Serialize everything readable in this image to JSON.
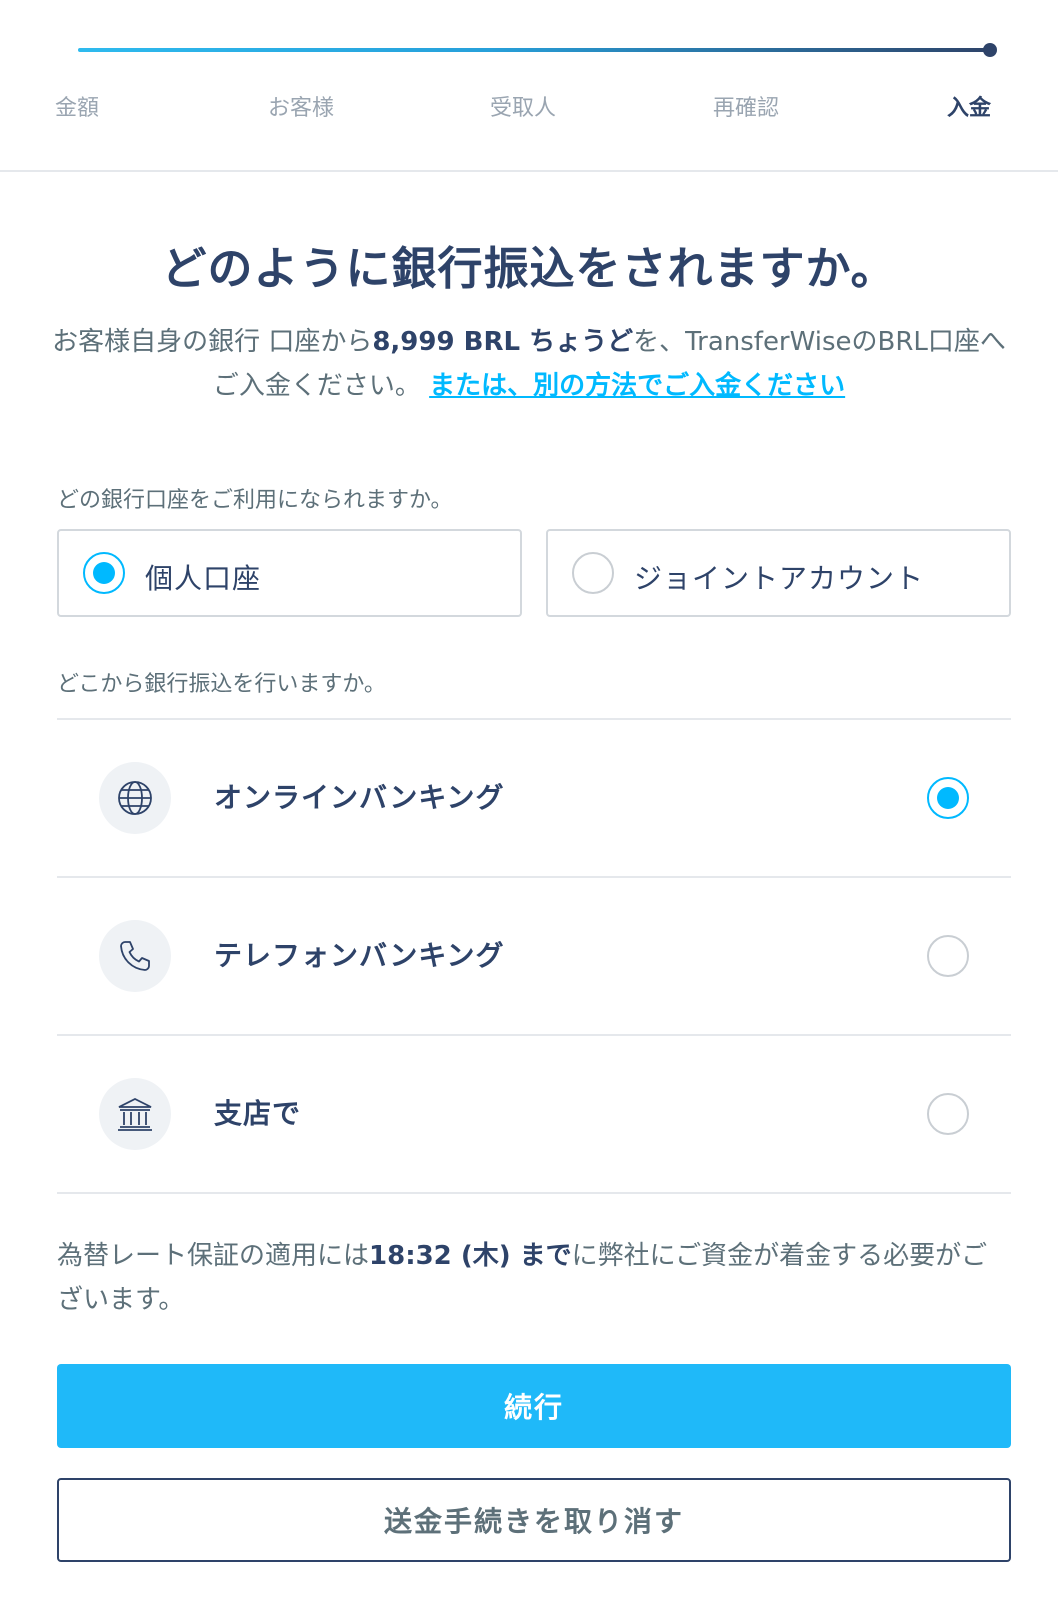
{
  "stepper": {
    "steps": [
      "金額",
      "お客様",
      "受取人",
      "再確認",
      "入金"
    ],
    "active_index": 4
  },
  "title": "どのように銀行振込をされますか。",
  "intro": {
    "text_1": "お客様自身の銀行 口座から",
    "amount": "8,999 BRL ちょうど",
    "text_2": "を、TransferWiseのBRL口座へご入金ください。",
    "link": "または、別の方法でご入金ください"
  },
  "account_question": "どの銀行口座をご利用になられますか。",
  "account_options": [
    {
      "label": "個人口座",
      "selected": true
    },
    {
      "label": "ジョイントアカウント",
      "selected": false
    }
  ],
  "method_question": "どこから銀行振込を行いますか。",
  "methods": [
    {
      "label": "オンラインバンキング",
      "icon": "globe-icon",
      "selected": true
    },
    {
      "label": "テレフォンバンキング",
      "icon": "phone-icon",
      "selected": false
    },
    {
      "label": "支店で",
      "icon": "bank-icon",
      "selected": false
    }
  ],
  "notice": {
    "text_1": "為替レート保証の適用には",
    "deadline": "18:32 (木) まで",
    "text_2": "に弊社にご資金が着金する必要がございます。"
  },
  "buttons": {
    "continue": "続行",
    "cancel": "送金手続きを取り消す"
  },
  "colors": {
    "accent": "#00b9ff",
    "primary_button": "#1fb9f9",
    "navy": "#2e4369",
    "muted_text": "#5d7079"
  }
}
